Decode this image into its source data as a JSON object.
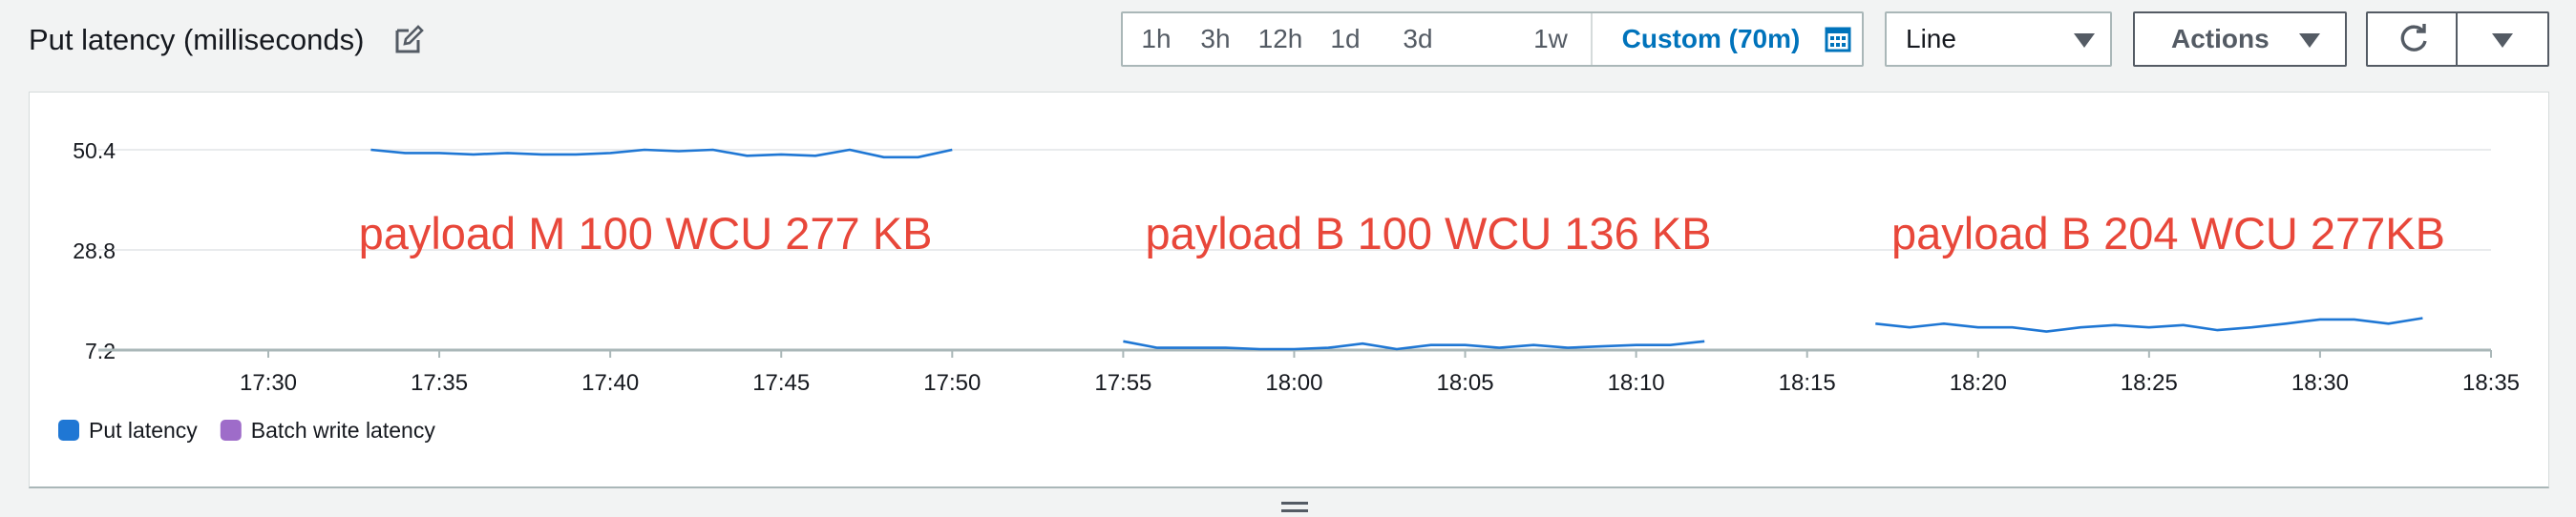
{
  "widget": {
    "title": "Put latency (milliseconds)",
    "time_ranges": [
      "1h",
      "3h",
      "12h",
      "1d",
      "3d",
      "1w"
    ],
    "custom_range": "Custom (70m)",
    "chart_type_value": "Line",
    "actions_label": "Actions",
    "icons": {
      "edit": "edit-icon",
      "calendar": "calendar-icon",
      "refresh": "refresh-icon",
      "dropdown": "caret-down-icon",
      "resize": "resize-handle-icon"
    }
  },
  "chart_data": {
    "type": "line",
    "y_ticks": [
      "50.4",
      "28.8",
      "7.2"
    ],
    "ylim": [
      7.2,
      50.4
    ],
    "x_ticks": [
      "17:30",
      "17:35",
      "17:40",
      "17:45",
      "17:50",
      "17:55",
      "18:00",
      "18:05",
      "18:10",
      "18:15",
      "18:20",
      "18:25",
      "18:30",
      "18:35"
    ],
    "xlim": [
      "17:30",
      "18:35"
    ],
    "grid": "horizontal",
    "legend_position": "bottom-left",
    "legend": [
      {
        "name": "Put latency",
        "color": "#1f77d4"
      },
      {
        "name": "Batch write latency",
        "color": "#9e6cc9"
      }
    ],
    "annotations": [
      {
        "text": "payload M 100 WCU 277 KB",
        "color": "#e8473a"
      },
      {
        "text": "payload B 100 WCU 136 KB",
        "color": "#e8473a"
      },
      {
        "text": "payload B  204 WCU 277KB",
        "color": "#e8473a"
      }
    ],
    "series": [
      {
        "name": "Put latency",
        "color": "#1f77d4",
        "segments": [
          {
            "x": [
              "17:33",
              "17:34",
              "17:35",
              "17:36",
              "17:37",
              "17:38",
              "17:39",
              "17:40",
              "17:41",
              "17:42",
              "17:43",
              "17:44",
              "17:45",
              "17:46",
              "17:47",
              "17:48",
              "17:49",
              "17:50"
            ],
            "y": [
              50.4,
              49.7,
              49.7,
              49.4,
              49.7,
              49.4,
              49.4,
              49.7,
              50.4,
              50.1,
              50.4,
              49.1,
              49.4,
              49.1,
              50.4,
              48.8,
              48.8,
              50.4
            ]
          },
          {
            "x": [
              "17:55",
              "17:56",
              "17:57",
              "17:58",
              "17:59",
              "18:00",
              "18:01",
              "18:02",
              "18:03",
              "18:04",
              "18:05",
              "18:06",
              "18:07",
              "18:08",
              "18:09",
              "18:10",
              "18:11",
              "18:12"
            ],
            "y": [
              9.1,
              7.7,
              7.7,
              7.7,
              7.4,
              7.4,
              7.7,
              8.6,
              7.4,
              8.3,
              8.3,
              7.7,
              8.3,
              7.7,
              8.0,
              8.3,
              8.3,
              9.1
            ]
          },
          {
            "x": [
              "18:17",
              "18:18",
              "18:19",
              "18:20",
              "18:21",
              "18:22",
              "18:23",
              "18:24",
              "18:25",
              "18:26",
              "18:27",
              "18:28",
              "18:29",
              "18:30",
              "18:31",
              "18:32",
              "18:33"
            ],
            "y": [
              12.9,
              12.1,
              12.9,
              12.1,
              12.1,
              11.2,
              12.1,
              12.6,
              12.1,
              12.6,
              11.5,
              12.1,
              12.9,
              13.8,
              13.8,
              12.9,
              14.1
            ]
          }
        ]
      },
      {
        "name": "Batch write latency",
        "color": "#9e6cc9",
        "segments": []
      }
    ]
  }
}
